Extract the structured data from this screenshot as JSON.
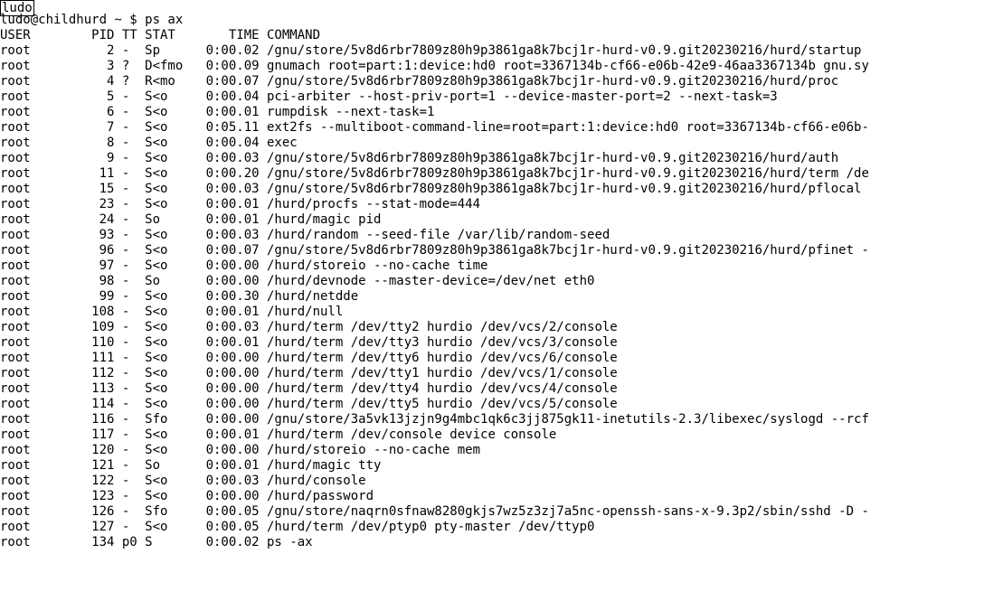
{
  "prompt": {
    "user": "ludo",
    "at": "@",
    "host": "childhurd",
    "cwd": "~",
    "sep": "$",
    "command": "ps ax"
  },
  "header": {
    "user": "USER",
    "pid": "PID",
    "tt": "TT",
    "stat": "STAT",
    "time": "TIME",
    "command": "COMMAND"
  },
  "rows": [
    {
      "user": "root",
      "pid": "2",
      "tt": "-",
      "stat": "Sp",
      "time": "0:00.02",
      "command": "/gnu/store/5v8d6rbr7809z80h9p3861ga8k7bcj1r-hurd-v0.9.git20230216/hurd/startup"
    },
    {
      "user": "root",
      "pid": "3",
      "tt": "?",
      "stat": "D<fmo",
      "time": "0:00.09",
      "command": "gnumach root=part:1:device:hd0 root=3367134b-cf66-e06b-42e9-46aa3367134b gnu.sy"
    },
    {
      "user": "root",
      "pid": "4",
      "tt": "?",
      "stat": "R<mo",
      "time": "0:00.07",
      "command": "/gnu/store/5v8d6rbr7809z80h9p3861ga8k7bcj1r-hurd-v0.9.git20230216/hurd/proc"
    },
    {
      "user": "root",
      "pid": "5",
      "tt": "-",
      "stat": "S<o",
      "time": "0:00.04",
      "command": "pci-arbiter --host-priv-port=1 --device-master-port=2 --next-task=3"
    },
    {
      "user": "root",
      "pid": "6",
      "tt": "-",
      "stat": "S<o",
      "time": "0:00.01",
      "command": "rumpdisk --next-task=1"
    },
    {
      "user": "root",
      "pid": "7",
      "tt": "-",
      "stat": "S<o",
      "time": "0:05.11",
      "command": "ext2fs --multiboot-command-line=root=part:1:device:hd0 root=3367134b-cf66-e06b-"
    },
    {
      "user": "root",
      "pid": "8",
      "tt": "-",
      "stat": "S<o",
      "time": "0:00.04",
      "command": "exec"
    },
    {
      "user": "root",
      "pid": "9",
      "tt": "-",
      "stat": "S<o",
      "time": "0:00.03",
      "command": "/gnu/store/5v8d6rbr7809z80h9p3861ga8k7bcj1r-hurd-v0.9.git20230216/hurd/auth"
    },
    {
      "user": "root",
      "pid": "11",
      "tt": "-",
      "stat": "S<o",
      "time": "0:00.20",
      "command": "/gnu/store/5v8d6rbr7809z80h9p3861ga8k7bcj1r-hurd-v0.9.git20230216/hurd/term /de"
    },
    {
      "user": "root",
      "pid": "15",
      "tt": "-",
      "stat": "S<o",
      "time": "0:00.03",
      "command": "/gnu/store/5v8d6rbr7809z80h9p3861ga8k7bcj1r-hurd-v0.9.git20230216/hurd/pflocal"
    },
    {
      "user": "root",
      "pid": "23",
      "tt": "-",
      "stat": "S<o",
      "time": "0:00.01",
      "command": "/hurd/procfs --stat-mode=444"
    },
    {
      "user": "root",
      "pid": "24",
      "tt": "-",
      "stat": "So",
      "time": "0:00.01",
      "command": "/hurd/magic pid"
    },
    {
      "user": "root",
      "pid": "93",
      "tt": "-",
      "stat": "S<o",
      "time": "0:00.03",
      "command": "/hurd/random --seed-file /var/lib/random-seed"
    },
    {
      "user": "root",
      "pid": "96",
      "tt": "-",
      "stat": "S<o",
      "time": "0:00.07",
      "command": "/gnu/store/5v8d6rbr7809z80h9p3861ga8k7bcj1r-hurd-v0.9.git20230216/hurd/pfinet -"
    },
    {
      "user": "root",
      "pid": "97",
      "tt": "-",
      "stat": "S<o",
      "time": "0:00.00",
      "command": "/hurd/storeio --no-cache time"
    },
    {
      "user": "root",
      "pid": "98",
      "tt": "-",
      "stat": "So",
      "time": "0:00.00",
      "command": "/hurd/devnode --master-device=/dev/net eth0"
    },
    {
      "user": "root",
      "pid": "99",
      "tt": "-",
      "stat": "S<o",
      "time": "0:00.30",
      "command": "/hurd/netdde"
    },
    {
      "user": "root",
      "pid": "108",
      "tt": "-",
      "stat": "S<o",
      "time": "0:00.01",
      "command": "/hurd/null"
    },
    {
      "user": "root",
      "pid": "109",
      "tt": "-",
      "stat": "S<o",
      "time": "0:00.03",
      "command": "/hurd/term /dev/tty2 hurdio /dev/vcs/2/console"
    },
    {
      "user": "root",
      "pid": "110",
      "tt": "-",
      "stat": "S<o",
      "time": "0:00.01",
      "command": "/hurd/term /dev/tty3 hurdio /dev/vcs/3/console"
    },
    {
      "user": "root",
      "pid": "111",
      "tt": "-",
      "stat": "S<o",
      "time": "0:00.00",
      "command": "/hurd/term /dev/tty6 hurdio /dev/vcs/6/console"
    },
    {
      "user": "root",
      "pid": "112",
      "tt": "-",
      "stat": "S<o",
      "time": "0:00.00",
      "command": "/hurd/term /dev/tty1 hurdio /dev/vcs/1/console"
    },
    {
      "user": "root",
      "pid": "113",
      "tt": "-",
      "stat": "S<o",
      "time": "0:00.00",
      "command": "/hurd/term /dev/tty4 hurdio /dev/vcs/4/console"
    },
    {
      "user": "root",
      "pid": "114",
      "tt": "-",
      "stat": "S<o",
      "time": "0:00.00",
      "command": "/hurd/term /dev/tty5 hurdio /dev/vcs/5/console"
    },
    {
      "user": "root",
      "pid": "116",
      "tt": "-",
      "stat": "Sfo",
      "time": "0:00.00",
      "command": "/gnu/store/3a5vk13jzjn9g4mbc1qk6c3jj875gk11-inetutils-2.3/libexec/syslogd --rcf"
    },
    {
      "user": "root",
      "pid": "117",
      "tt": "-",
      "stat": "S<o",
      "time": "0:00.01",
      "command": "/hurd/term /dev/console device console"
    },
    {
      "user": "root",
      "pid": "120",
      "tt": "-",
      "stat": "S<o",
      "time": "0:00.00",
      "command": "/hurd/storeio --no-cache mem"
    },
    {
      "user": "root",
      "pid": "121",
      "tt": "-",
      "stat": "So",
      "time": "0:00.01",
      "command": "/hurd/magic tty"
    },
    {
      "user": "root",
      "pid": "122",
      "tt": "-",
      "stat": "S<o",
      "time": "0:00.03",
      "command": "/hurd/console"
    },
    {
      "user": "root",
      "pid": "123",
      "tt": "-",
      "stat": "S<o",
      "time": "0:00.00",
      "command": "/hurd/password"
    },
    {
      "user": "root",
      "pid": "126",
      "tt": "-",
      "stat": "Sfo",
      "time": "0:00.05",
      "command": "/gnu/store/naqrn0sfnaw8280gkjs7wz5z3zj7a5nc-openssh-sans-x-9.3p2/sbin/sshd -D -"
    },
    {
      "user": "root",
      "pid": "127",
      "tt": "-",
      "stat": "S<o",
      "time": "0:00.05",
      "command": "/hurd/term /dev/ptyp0 pty-master /dev/ttyp0"
    },
    {
      "user": "root",
      "pid": "134",
      "tt": "p0",
      "stat": "S",
      "time": "0:00.02",
      "command": "ps -ax"
    }
  ]
}
